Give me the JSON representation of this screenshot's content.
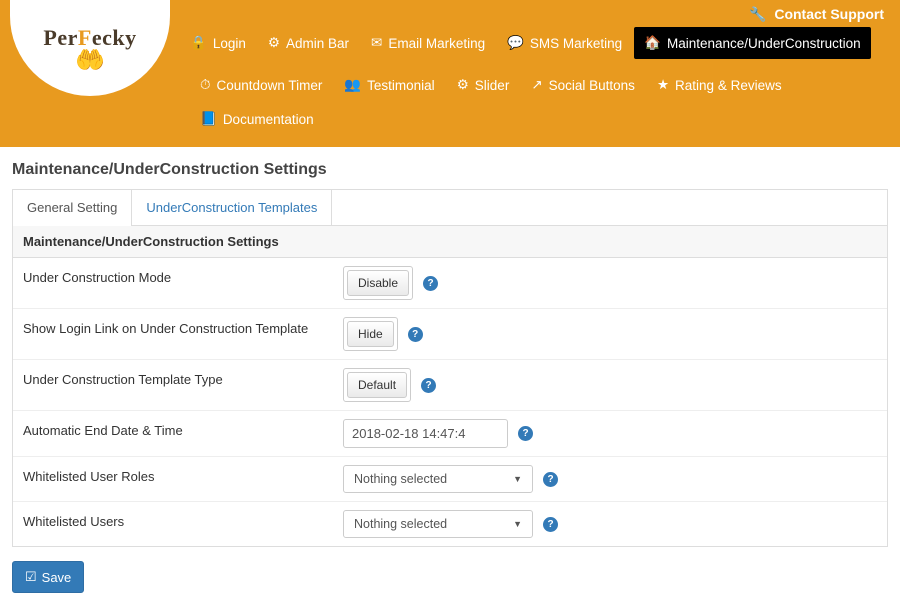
{
  "header": {
    "contact": "Contact Support",
    "logo": "PerFecky"
  },
  "nav": {
    "row1": [
      {
        "icon": "🔒",
        "label": "Login"
      },
      {
        "icon": "⚙",
        "label": "Admin Bar"
      },
      {
        "icon": "✉",
        "label": "Email Marketing"
      },
      {
        "icon": "💬",
        "label": "SMS Marketing"
      },
      {
        "icon": "🏠",
        "label": "Maintenance/UnderConstruction",
        "active": true
      }
    ],
    "row2": [
      {
        "icon": "⏱",
        "label": "Countdown Timer"
      },
      {
        "icon": "👥",
        "label": "Testimonial"
      },
      {
        "icon": "⚙",
        "label": "Slider"
      },
      {
        "icon": "↗",
        "label": "Social Buttons"
      },
      {
        "icon": "★",
        "label": "Rating & Reviews"
      },
      {
        "icon": "📘",
        "label": "Documentation"
      }
    ]
  },
  "page": {
    "title": "Maintenance/UnderConstruction Settings",
    "tabs": [
      {
        "label": "General Setting",
        "active": true
      },
      {
        "label": "UnderConstruction Templates",
        "active": false
      }
    ],
    "panel_header": "Maintenance/UnderConstruction Settings",
    "rows": [
      {
        "label": "Under Construction Mode",
        "type": "toggle",
        "value": "Disable"
      },
      {
        "label": "Show Login Link on Under Construction Template",
        "type": "toggle",
        "value": "Hide"
      },
      {
        "label": "Under Construction Template Type",
        "type": "toggle",
        "value": "Default"
      },
      {
        "label": "Automatic End Date & Time",
        "type": "text",
        "value": "2018-02-18 14:47:4"
      },
      {
        "label": "Whitelisted User Roles",
        "type": "select",
        "value": "Nothing selected"
      },
      {
        "label": "Whitelisted Users",
        "type": "select",
        "value": "Nothing selected"
      }
    ],
    "save": "Save"
  }
}
